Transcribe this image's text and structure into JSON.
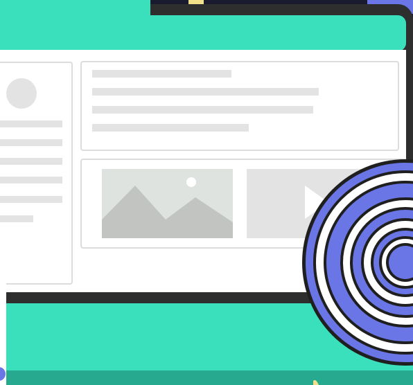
{
  "illustration": {
    "kind": "flat web layout wireframe on a laptop screen with a target",
    "colors": {
      "background": "#1a1a2e",
      "frame": "#2e2e2e",
      "accent": "#3adfbb",
      "accent_dark": "#27a98f",
      "panel": "#ffffff",
      "placeholder": "#e3e3e3",
      "placeholder_border": "#dcdcdc",
      "image_bg": "#dfe3df",
      "mountain": "#c2c4c2",
      "target_blue": "#6a76e6",
      "target_white": "#ffffff",
      "target_outline": "#1f1f1f",
      "corner_yellow": "#f0e08a"
    },
    "icons": [
      "avatar-placeholder-icon",
      "image-placeholder-icon",
      "play-icon",
      "target-icon"
    ]
  }
}
